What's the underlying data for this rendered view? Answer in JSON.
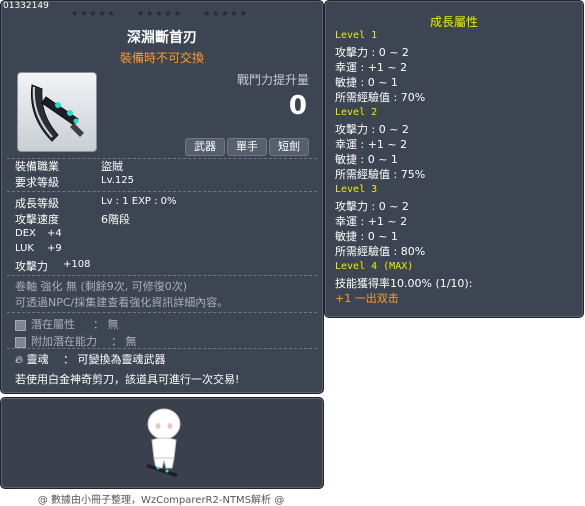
{
  "item": {
    "id": "01332149",
    "stars": "★★★★★",
    "name": "深淵斷首刃",
    "untradable": "裝備時不可交換",
    "power_label": "戰鬥力提升量",
    "power_value": "0",
    "tags": [
      "武器",
      "單手",
      "短劍"
    ],
    "job_label": "裝備職業",
    "job_value": "盜賊",
    "req_level_label": "要求等級",
    "req_level_value": "Lv.125",
    "growth_level_label": "成長等級",
    "growth_level_value": "Lv : 1   EXP : 0%",
    "attack_speed_label": "攻擊速度",
    "attack_speed_value": "6階段",
    "stats": [
      {
        "label": "DEX",
        "value": "+4"
      },
      {
        "label": "LUK",
        "value": "+9"
      },
      {
        "label": "攻擊力",
        "value": "+108"
      }
    ],
    "upgrade_text": "卷軸 強化 無 (剩餘9次, 可修復0次)",
    "upgrade_hint": "可透過NPC/採集建查看強化資訊詳細內容。",
    "potential_label": "潛在屬性",
    "potential_value": "： 無",
    "bonus_potential_label": "附加潛在能力",
    "bonus_potential_value": "： 無",
    "soul_label": "靈魂",
    "soul_value": "： 可變換為靈魂武器",
    "scissors_note": "若使用白金神奇剪刀，該道具可進行一次交易!"
  },
  "growth": {
    "title": "成長屬性",
    "levels": [
      {
        "label": "Level 1",
        "lines": [
          "攻擊力 : 0 ~ 2",
          "幸運 : +1 ~ 2",
          "敏捷 : 0 ~ 1",
          "所需經驗值 : 70%"
        ]
      },
      {
        "label": "Level 2",
        "lines": [
          "攻擊力 : 0 ~ 2",
          "幸運 : +1 ~ 2",
          "敏捷 : 0 ~ 1",
          "所需經驗值 : 75%"
        ]
      },
      {
        "label": "Level 3",
        "lines": [
          "攻擊力 : 0 ~ 2",
          "幸運 : +1 ~ 2",
          "敏捷 : 0 ~ 1",
          "所需經驗值 : 80%"
        ]
      },
      {
        "label": "Level 4 (MAX)",
        "lines": [
          "技能獲得率10.00% (1/10):"
        ]
      }
    ],
    "combo": "+1 一出双击"
  },
  "footer": "@ 數據由小冊子整理，WzComparerR2-NTMS解析 @"
}
